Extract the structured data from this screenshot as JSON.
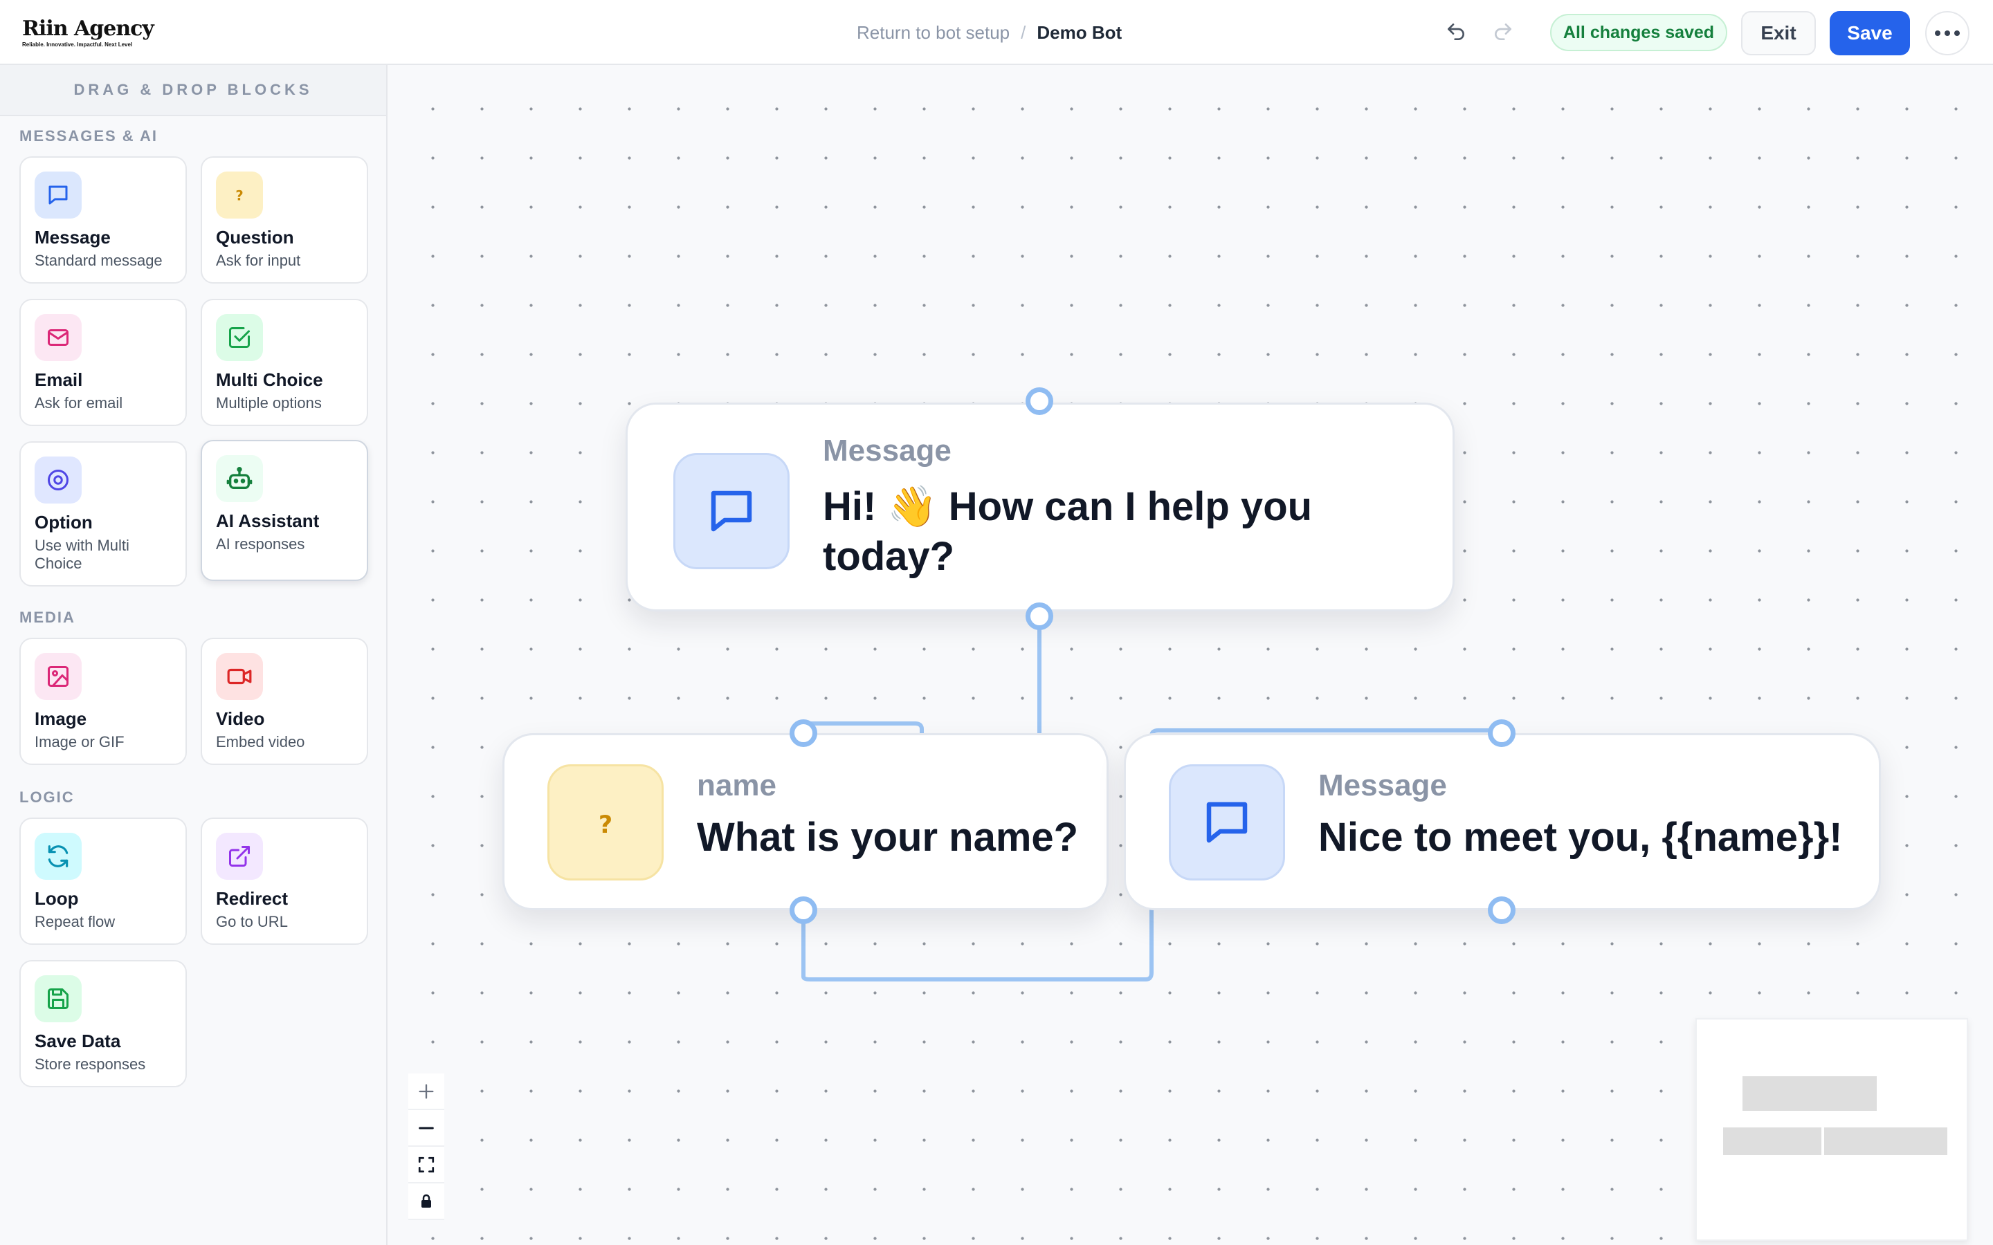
{
  "brand": {
    "name": "Riin Agency",
    "tagline": "Reliable. Innovative. Impactful. Next Level"
  },
  "header": {
    "breadcrumb_link": "Return to bot setup",
    "breadcrumb_separator": "/",
    "breadcrumb_current": "Demo Bot",
    "undo_icon": "undo-icon",
    "redo_icon": "redo-icon",
    "status": "All changes saved",
    "exit_label": "Exit",
    "save_label": "Save",
    "more_icon": "more-horizontal-icon"
  },
  "sidebar": {
    "title": "DRAG & DROP BLOCKS",
    "sections": [
      {
        "title": "MESSAGES & AI",
        "blocks": [
          {
            "label": "Message",
            "desc": "Standard message",
            "icon": "message-icon",
            "color": "#2563eb",
            "bg": "#dbe7fd"
          },
          {
            "label": "Question",
            "desc": "Ask for input",
            "icon": "question-icon",
            "color": "#ca8a04",
            "bg": "#fdf0c4"
          },
          {
            "label": "Email",
            "desc": "Ask for email",
            "icon": "mail-icon",
            "color": "#db2777",
            "bg": "#fce7f3"
          },
          {
            "label": "Multi Choice",
            "desc": "Multiple options",
            "icon": "checkbox-icon",
            "color": "#16a34a",
            "bg": "#dcfce7"
          },
          {
            "label": "Option",
            "desc": "Use with Multi Choice",
            "icon": "option-circle-icon",
            "color": "#4f46e5",
            "bg": "#e0e7ff"
          },
          {
            "label": "AI Assistant",
            "desc": "AI responses",
            "icon": "robot-icon",
            "color": "#15803d",
            "bg": "#ecfdf3"
          }
        ]
      },
      {
        "title": "MEDIA",
        "blocks": [
          {
            "label": "Image",
            "desc": "Image or GIF",
            "icon": "image-icon",
            "color": "#db2777",
            "bg": "#fce7f3"
          },
          {
            "label": "Video",
            "desc": "Embed video",
            "icon": "video-icon",
            "color": "#dc2626",
            "bg": "#fee2e2"
          }
        ]
      },
      {
        "title": "LOGIC",
        "blocks": [
          {
            "label": "Loop",
            "desc": "Repeat flow",
            "icon": "loop-icon",
            "color": "#0891b2",
            "bg": "#cffafe"
          },
          {
            "label": "Redirect",
            "desc": "Go to URL",
            "icon": "external-link-icon",
            "color": "#9333ea",
            "bg": "#f3e8ff"
          },
          {
            "label": "Save Data",
            "desc": "Store responses",
            "icon": "save-icon",
            "color": "#16a34a",
            "bg": "#dcfce7"
          }
        ]
      }
    ]
  },
  "canvas": {
    "nodes": [
      {
        "type": "Message",
        "text": "Hi! 👋 How can I help you today?",
        "icon": "message-icon"
      },
      {
        "type": "name",
        "text": "What is your name?",
        "icon": "question-icon"
      },
      {
        "type": "Message",
        "text": "Nice to meet you, {{name}}!",
        "icon": "message-icon"
      }
    ],
    "zoom_controls": [
      "zoom-in-icon",
      "zoom-out-icon",
      "fit-view-icon",
      "lock-icon"
    ]
  }
}
